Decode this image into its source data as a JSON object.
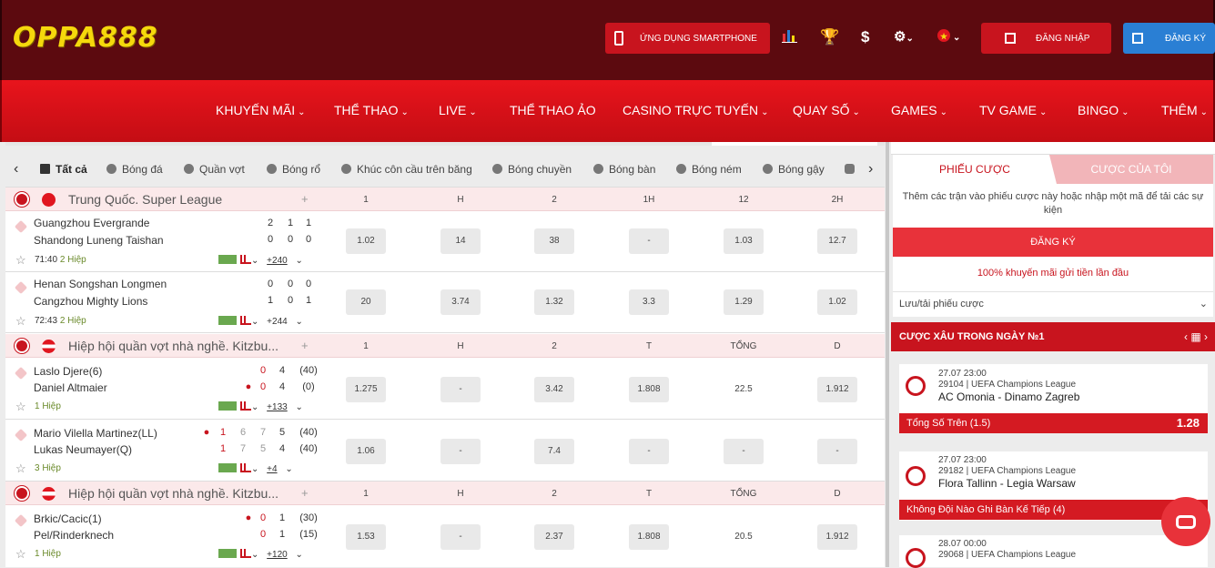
{
  "header": {
    "logo": "OPPA888",
    "app_button": "ỨNG DỤNG SMARTPHONE",
    "login": "ĐĂNG NHẬP",
    "register": "ĐĂNG KÝ",
    "icons": [
      "chart-icon",
      "trophy-icon",
      "dollar-icon",
      "gear-icon",
      "vietnam-flag-icon"
    ]
  },
  "nav": [
    {
      "label": "KHUYẾN MÃI",
      "chev": "⌄"
    },
    {
      "label": "THỂ THAO",
      "chev": "⌄"
    },
    {
      "label": "LIVE",
      "chev": "⌄"
    },
    {
      "label": "THỂ THAO ẢO",
      "chev": ""
    },
    {
      "label": "CASINO TRỰC TUYẾN",
      "chev": "⌄"
    },
    {
      "label": "QUAY SỐ",
      "chev": "⌄"
    },
    {
      "label": "GAMES",
      "chev": "⌄"
    },
    {
      "label": "TV GAME",
      "chev": "⌄"
    },
    {
      "label": "BINGO",
      "chev": "⌄"
    },
    {
      "label": "THÊM",
      "chev": "⌄"
    }
  ],
  "sports": [
    "Tất cả",
    "Bóng đá",
    "Quần vợt",
    "Bóng rổ",
    "Khúc côn cầu trên băng",
    "Bóng chuyền",
    "Bóng bàn",
    "Bóng ném",
    "Bóng gậy"
  ],
  "leagues": [
    {
      "name": "Trung Quốc. Super League",
      "plus": "+",
      "headers": [
        "1",
        "H",
        "2",
        "1H",
        "12",
        "2H"
      ]
    },
    {
      "name": "Hiệp hội quần vợt nhà nghề. Kitzbu...",
      "plus": "+",
      "headers": [
        "1",
        "H",
        "2",
        "T",
        "TỔNG",
        "D"
      ]
    },
    {
      "name": "Hiệp hội quần vợt nhà nghề. Kitzbu...",
      "plus": "+",
      "headers": [
        "1",
        "H",
        "2",
        "T",
        "TỔNG",
        "D"
      ]
    }
  ],
  "matches": [
    {
      "t1": "Guangzhou Evergrande",
      "t2": "Shandong Luneng Taishan",
      "s1": [
        "2",
        "1",
        "1"
      ],
      "s2": [
        "0",
        "0",
        "0"
      ],
      "time": "71:40",
      "period": "2 Hiệp",
      "more": "+240",
      "odds": [
        "1.02",
        "14",
        "38",
        "-",
        "1.03",
        "12.7"
      ]
    },
    {
      "t1": "Henan Songshan Longmen",
      "t2": "Cangzhou Mighty Lions",
      "s1": [
        "0",
        "0",
        "0"
      ],
      "s2": [
        "1",
        "0",
        "1"
      ],
      "time": "72:43",
      "period": "2 Hiệp",
      "more": "+244",
      "odds": [
        "20",
        "3.74",
        "1.32",
        "3.3",
        "1.29",
        "1.02"
      ]
    },
    {
      "t1": "Laslo Djere(6)",
      "t2": "Daniel Altmaier",
      "s1": [
        "0",
        "4",
        "(40)"
      ],
      "s2": [
        "0",
        "4",
        "(0)"
      ],
      "time": "",
      "period": "1 Hiệp",
      "more": "+133",
      "odds": [
        "1.275",
        "-",
        "3.42",
        "1.808",
        "22.5",
        "1.912"
      ]
    },
    {
      "t1": "Mario Vilella Martinez(LL)",
      "t2": "Lukas Neumayer(Q)",
      "s1": [
        "1",
        "6",
        "7",
        "5",
        "(40)"
      ],
      "s2": [
        "1",
        "7",
        "5",
        "4",
        "(40)"
      ],
      "time": "",
      "period": "3 Hiệp",
      "more": "+4",
      "odds": [
        "1.06",
        "-",
        "7.4",
        "-",
        "-",
        "-"
      ]
    },
    {
      "t1": "Brkic/Cacic(1)",
      "t2": "Pel/Rinderknech",
      "s1": [
        "0",
        "1",
        "(30)"
      ],
      "s2": [
        "0",
        "1",
        "(15)"
      ],
      "time": "",
      "period": "1 Hiệp",
      "more": "+120",
      "odds": [
        "1.53",
        "-",
        "2.37",
        "1.808",
        "20.5",
        "1.912"
      ]
    }
  ],
  "betslip": {
    "tab_slip": "PHIẾU CƯỢC",
    "tab_mine": "CƯỢC CỦA TÔI",
    "message": "Thêm các trận vào phiếu cược này hoặc nhập một mã để tải các sự kiện",
    "register": "ĐĂNG KÝ",
    "promo": "100% khuyến mãi gửi tiền lần đầu",
    "save": "Lưu/tải phiếu cược",
    "save_chev": "⌄"
  },
  "accumulator": {
    "title": "CƯỢC XÂU TRONG NGÀY №1",
    "cards": [
      {
        "date": "27.07 23:00",
        "league": "29104 | UEFA Champions League",
        "teams": "AC Omonia - Dinamo Zagreb",
        "pick": "Tổng Số Trên (1.5)",
        "odd": "1.28"
      },
      {
        "date": "27.07 23:00",
        "league": "29182 | UEFA Champions League",
        "teams": "Flora Tallinn - Legia Warsaw",
        "pick": "Không Đội Nào Ghi Bàn Kế Tiếp (4)",
        "odd": ""
      },
      {
        "date": "28.07 00:00",
        "league": "29068 | UEFA Champions League",
        "teams": "",
        "pick": "",
        "odd": ""
      }
    ]
  },
  "colors": {
    "brand_red": "#c8141e",
    "dark": "#5c0a0f",
    "logo": "#f5d80c",
    "register_blue": "#2a7fd4"
  }
}
